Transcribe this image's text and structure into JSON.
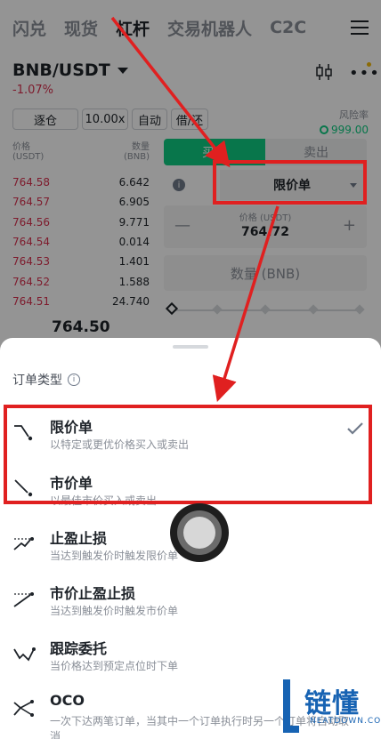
{
  "nav": {
    "tabs": [
      "闪兑",
      "现货",
      "杠杆",
      "交易机器人",
      "C2C"
    ],
    "active_index": 2,
    "menu_icon": "hamburger-menu-icon"
  },
  "pair": {
    "symbol": "BNB/USDT",
    "change": "-1.07%"
  },
  "controls": {
    "margin_mode": "逐仓",
    "leverage": "10.00x",
    "auto": "自动",
    "borrow": "借/还"
  },
  "risk": {
    "label": "风险率",
    "value": "999.00"
  },
  "orderbook": {
    "price_header": "价格",
    "price_unit": "(USDT)",
    "qty_header": "数量",
    "qty_unit": "(BNB)",
    "rows": [
      {
        "price": "764.58",
        "qty": "6.642"
      },
      {
        "price": "764.57",
        "qty": "6.905"
      },
      {
        "price": "764.56",
        "qty": "9.771"
      },
      {
        "price": "764.54",
        "qty": "0.014"
      },
      {
        "price": "764.53",
        "qty": "1.401"
      },
      {
        "price": "764.52",
        "qty": "1.588"
      },
      {
        "price": "764.51",
        "qty": "24.740"
      }
    ],
    "last_price": "764.50"
  },
  "trade_panel": {
    "buy_tab": "买入",
    "sell_tab": "卖出",
    "order_type": "限价单",
    "price_label": "价格 (USDT)",
    "price_value": "764.72",
    "qty_placeholder": "数量 (BNB)",
    "minus": "—",
    "plus": "+"
  },
  "sheet": {
    "title": "订单类型",
    "options": [
      {
        "name": "限价单",
        "desc": "以特定或更优价格买入或卖出",
        "icon": "limit-order-icon",
        "selected": true
      },
      {
        "name": "市价单",
        "desc": "以最佳市价买入或卖出",
        "icon": "market-order-icon",
        "selected": false
      },
      {
        "name": "止盈止损",
        "desc": "当达到触发价时触发限价单",
        "icon": "stop-limit-icon",
        "selected": false
      },
      {
        "name": "市价止盈止损",
        "desc": "当达到触发价时触发市价单",
        "icon": "stop-market-icon",
        "selected": false
      },
      {
        "name": "跟踪委托",
        "desc": "当价格达到预定点位时下单",
        "icon": "trailing-stop-icon",
        "selected": false
      },
      {
        "name": "OCO",
        "desc": "一次下达两笔订单，当其中一个订单执行时另一个订单将自动取消",
        "icon": "oco-icon",
        "selected": false
      }
    ]
  },
  "watermark": {
    "text": "链懂",
    "sub": "NEATDOWN.COM"
  },
  "colors": {
    "up": "#0ecb81",
    "down": "#d9304e",
    "annotation": "#e02020",
    "brand_watermark": "#1763b3"
  }
}
